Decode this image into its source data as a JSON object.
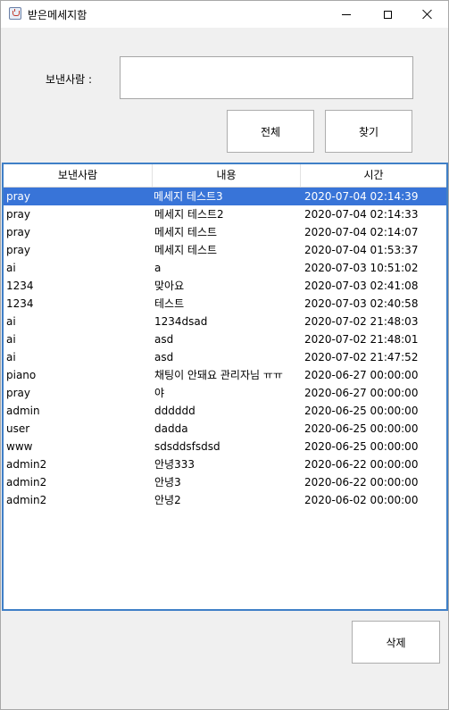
{
  "window": {
    "title": "받은메세지함",
    "icon": "java-cup-icon"
  },
  "search": {
    "label": "보낸사람 :",
    "value": "",
    "placeholder": ""
  },
  "buttons": {
    "all": "전체",
    "find": "찾기",
    "delete": "삭제"
  },
  "table": {
    "headers": [
      "보낸사람",
      "내용",
      "시간"
    ],
    "selected_row": 0,
    "rows": [
      {
        "sender": "pray",
        "content": "메세지 테스트3",
        "time": "2020-07-04 02:14:39"
      },
      {
        "sender": "pray",
        "content": "메세지 테스트2",
        "time": "2020-07-04 02:14:33"
      },
      {
        "sender": "pray",
        "content": "메세지 테스트",
        "time": "2020-07-04 02:14:07"
      },
      {
        "sender": "pray",
        "content": "메세지 테스트",
        "time": "2020-07-04 01:53:37"
      },
      {
        "sender": "ai",
        "content": "a",
        "time": "2020-07-03 10:51:02"
      },
      {
        "sender": "1234",
        "content": "맞아요",
        "time": "2020-07-03 02:41:08"
      },
      {
        "sender": "1234",
        "content": "테스트",
        "time": "2020-07-03 02:40:58"
      },
      {
        "sender": "ai",
        "content": "1234dsad",
        "time": "2020-07-02 21:48:03"
      },
      {
        "sender": "ai",
        "content": "asd",
        "time": "2020-07-02 21:48:01"
      },
      {
        "sender": "ai",
        "content": "asd",
        "time": "2020-07-02 21:47:52"
      },
      {
        "sender": "piano",
        "content": "채팅이 안돼요 관리자님 ㅠㅠ",
        "time": "2020-06-27 00:00:00"
      },
      {
        "sender": "pray",
        "content": "야",
        "time": "2020-06-27 00:00:00"
      },
      {
        "sender": "admin",
        "content": "dddddd",
        "time": "2020-06-25 00:00:00"
      },
      {
        "sender": "user",
        "content": "dadda",
        "time": "2020-06-25 00:00:00"
      },
      {
        "sender": "www",
        "content": "sdsddsfsdsd",
        "time": "2020-06-25 00:00:00"
      },
      {
        "sender": "admin2",
        "content": "안녕333",
        "time": "2020-06-22 00:00:00"
      },
      {
        "sender": "admin2",
        "content": "안녕3",
        "time": "2020-06-22 00:00:00"
      },
      {
        "sender": "admin2",
        "content": "안녕2",
        "time": "2020-06-02 00:00:00"
      }
    ]
  },
  "colors": {
    "selection": "#3874d8",
    "table_border": "#3f7fc7",
    "window_bg": "#f0f0f0"
  }
}
